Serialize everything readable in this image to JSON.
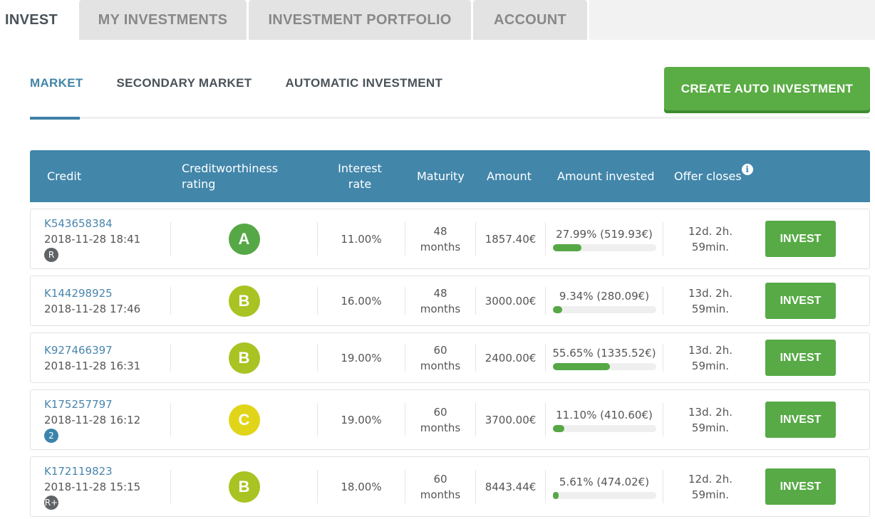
{
  "top_tabs": [
    {
      "label": "INVEST",
      "active": true
    },
    {
      "label": "MY INVESTMENTS",
      "active": false
    },
    {
      "label": "INVESTMENT PORTFOLIO",
      "active": false
    },
    {
      "label": "ACCOUNT",
      "active": false
    }
  ],
  "sub_tabs": [
    {
      "label": "MARKET",
      "active": true
    },
    {
      "label": "SECONDARY MARKET",
      "active": false
    },
    {
      "label": "AUTOMATIC INVESTMENT",
      "active": false
    }
  ],
  "create_button": "CREATE AUTO INVESTMENT",
  "table": {
    "headers": {
      "credit": "Credit",
      "rating": "Creditworthiness rating",
      "interest": "Interest rate",
      "maturity": "Maturity",
      "amount": "Amount",
      "invested": "Amount invested",
      "closes": "Offer closes",
      "info_icon": "i"
    },
    "rows": [
      {
        "id": "K543658384",
        "date": "2018-11-28 18:41",
        "badge": "R",
        "badge_color": "#5f6366",
        "rating": "A",
        "rating_color": "#56a846",
        "interest": "11.00%",
        "maturity_num": "48",
        "maturity_unit": "months",
        "amount": "1857.40€",
        "invested_label": "27.99% (519.93€)",
        "invested_pct": 27.99,
        "closes_1": "12d. 2h.",
        "closes_2": "59min.",
        "action": "INVEST"
      },
      {
        "id": "K144298925",
        "date": "2018-11-28 17:46",
        "badge": "",
        "badge_color": "",
        "rating": "B",
        "rating_color": "#a9c322",
        "interest": "16.00%",
        "maturity_num": "48",
        "maturity_unit": "months",
        "amount": "3000.00€",
        "invested_label": "9.34% (280.09€)",
        "invested_pct": 9.34,
        "closes_1": "13d. 2h.",
        "closes_2": "59min.",
        "action": "INVEST"
      },
      {
        "id": "K927466397",
        "date": "2018-11-28 16:31",
        "badge": "",
        "badge_color": "",
        "rating": "B",
        "rating_color": "#a9c322",
        "interest": "19.00%",
        "maturity_num": "60",
        "maturity_unit": "months",
        "amount": "2400.00€",
        "invested_label": "55.65% (1335.52€)",
        "invested_pct": 55.65,
        "closes_1": "13d. 2h.",
        "closes_2": "59min.",
        "action": "INVEST"
      },
      {
        "id": "K175257797",
        "date": "2018-11-28 16:12",
        "badge": "2",
        "badge_color": "#3a84ac",
        "rating": "C",
        "rating_color": "#e1d51a",
        "interest": "19.00%",
        "maturity_num": "60",
        "maturity_unit": "months",
        "amount": "3700.00€",
        "invested_label": "11.10% (410.60€)",
        "invested_pct": 11.1,
        "closes_1": "13d. 2h.",
        "closes_2": "59min.",
        "action": "INVEST"
      },
      {
        "id": "K172119823",
        "date": "2018-11-28 15:15",
        "badge": "R+",
        "badge_color": "#5f6366",
        "rating": "B",
        "rating_color": "#a9c322",
        "interest": "18.00%",
        "maturity_num": "60",
        "maturity_unit": "months",
        "amount": "8443.44€",
        "invested_label": "5.61% (474.02€)",
        "invested_pct": 5.61,
        "closes_1": "12d. 2h.",
        "closes_2": "59min.",
        "action": "INVEST"
      }
    ]
  }
}
